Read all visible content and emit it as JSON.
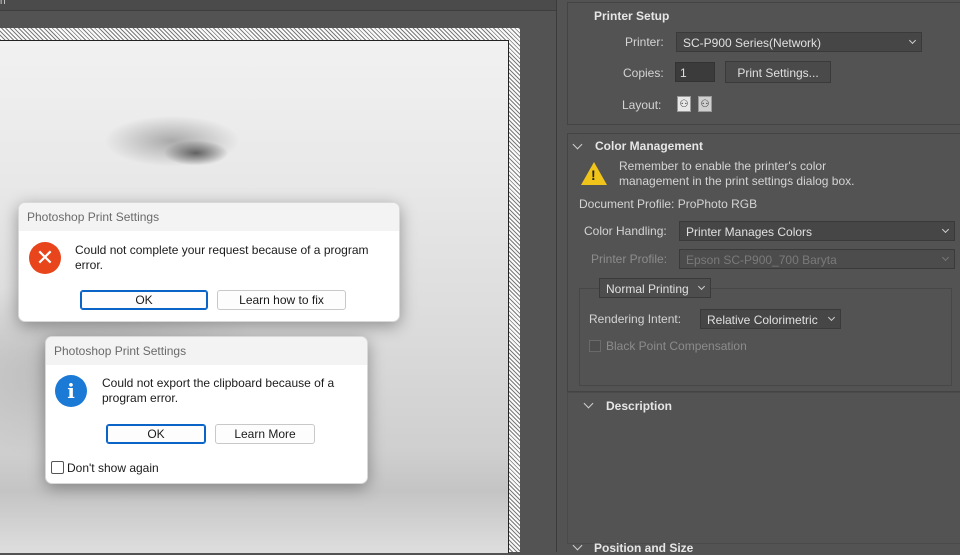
{
  "window": {
    "corner_text": "n"
  },
  "error_dialog": {
    "title": "Photoshop Print Settings",
    "message_line1": "Could not complete your request because of a program",
    "message_line2": "error.",
    "ok_label": "OK",
    "fix_label": "Learn how to fix",
    "icon": "error-icon",
    "icon_glyph": "✕"
  },
  "info_dialog": {
    "title": "Photoshop Print Settings",
    "message_line1": "Could not export the clipboard because of a",
    "message_line2": "program error.",
    "ok_label": "OK",
    "more_label": "Learn More",
    "checkbox_label": "Don't show again",
    "icon": "info-icon",
    "icon_glyph": "i"
  },
  "printer_setup": {
    "title": "Printer Setup",
    "printer_label": "Printer:",
    "printer_value": "SC-P900 Series(Network)",
    "copies_label": "Copies:",
    "copies_value": "1",
    "print_settings_label": "Print Settings...",
    "layout_label": "Layout:"
  },
  "color_management": {
    "title": "Color Management",
    "warning_line1": "Remember to enable the printer's color",
    "warning_line2": "management in the print settings dialog box.",
    "document_profile": "Document Profile: ProPhoto RGB",
    "handling_label": "Color Handling:",
    "handling_value": "Printer Manages Colors",
    "profile_label": "Printer Profile:",
    "profile_value": "Epson SC-P900_700 Baryta",
    "printing_mode": "Normal Printing",
    "intent_label": "Rendering Intent:",
    "intent_value": "Relative Colorimetric",
    "bpc_label": "Black Point Compensation"
  },
  "description": {
    "title": "Description"
  },
  "position_size": {
    "title": "Position and Size"
  },
  "colors": {
    "panel_bg": "#535353",
    "error_red": "#e8451c",
    "info_blue": "#1a7ad6",
    "warning_yellow": "#f0c419",
    "button_focus": "#0a64c8"
  }
}
